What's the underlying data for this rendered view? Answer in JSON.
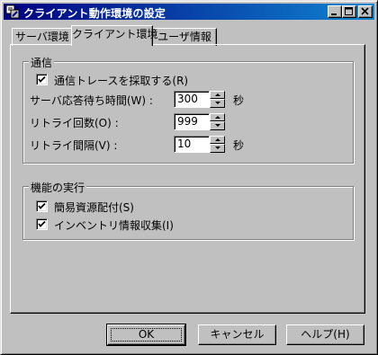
{
  "window": {
    "title": "クライアント動作環境の設定"
  },
  "tabs": [
    {
      "label": "サーバ環境"
    },
    {
      "label": "クライアント環境"
    },
    {
      "label": "ユーザ情報"
    }
  ],
  "communication": {
    "group_title": "通信",
    "trace": {
      "label": "通信トレースを採取する(R)",
      "checked": true
    },
    "timeout": {
      "label": "サーバ応答待ち時間(W) :",
      "value": "300",
      "unit": "秒"
    },
    "retry_count": {
      "label": "リトライ回数(O) :",
      "value": "999"
    },
    "retry_interval": {
      "label": "リトライ間隔(V) :",
      "value": "10",
      "unit": "秒"
    }
  },
  "features": {
    "group_title": "機能の実行",
    "simple_distribution": {
      "label": "簡易資源配付(S)",
      "checked": true
    },
    "inventory": {
      "label": "インベントリ情報収集(I)",
      "checked": true
    }
  },
  "buttons": {
    "ok": "OK",
    "cancel": "キャンセル",
    "help": "ヘルプ(H)"
  },
  "icons": {
    "app": "app-settings-icon",
    "minimize": "minimize-icon",
    "maximize": "maximize-icon",
    "close": "close-icon",
    "checkmark": "checkmark-icon",
    "spin_up": "spin-up-icon",
    "spin_down": "spin-down-icon"
  },
  "colors": {
    "titlebar_start": "#000080",
    "titlebar_end": "#1084d0",
    "face": "#c0c0c0"
  }
}
